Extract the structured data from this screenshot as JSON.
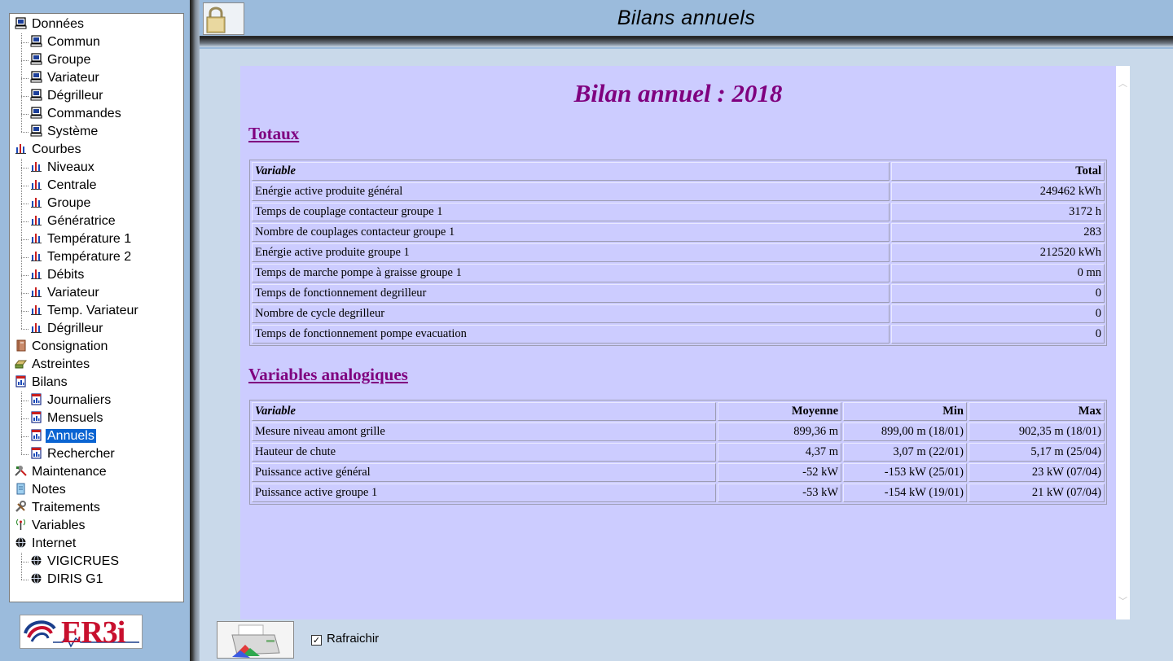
{
  "window": {
    "title": "Bilans annuels"
  },
  "tree": {
    "items": [
      {
        "label": "Données",
        "icon": "computer-icon",
        "level": 0
      },
      {
        "label": "Commun",
        "icon": "computer-icon",
        "level": 1
      },
      {
        "label": "Groupe",
        "icon": "computer-icon",
        "level": 1
      },
      {
        "label": "Variateur",
        "icon": "computer-icon",
        "level": 1
      },
      {
        "label": "Dégrilleur",
        "icon": "computer-icon",
        "level": 1
      },
      {
        "label": "Commandes",
        "icon": "computer-icon",
        "level": 1
      },
      {
        "label": "Système",
        "icon": "computer-icon",
        "level": 1
      },
      {
        "label": "Courbes",
        "icon": "bar-chart-icon",
        "level": 0
      },
      {
        "label": "Niveaux",
        "icon": "bar-chart-icon",
        "level": 1
      },
      {
        "label": "Centrale",
        "icon": "bar-chart-icon",
        "level": 1
      },
      {
        "label": "Groupe",
        "icon": "bar-chart-icon",
        "level": 1
      },
      {
        "label": "Génératrice",
        "icon": "bar-chart-icon",
        "level": 1
      },
      {
        "label": "Température 1",
        "icon": "bar-chart-icon",
        "level": 1
      },
      {
        "label": "Température 2",
        "icon": "bar-chart-icon",
        "level": 1
      },
      {
        "label": "Débits",
        "icon": "bar-chart-icon",
        "level": 1
      },
      {
        "label": "Variateur",
        "icon": "bar-chart-icon",
        "level": 1
      },
      {
        "label": "Temp. Variateur",
        "icon": "bar-chart-icon",
        "level": 1
      },
      {
        "label": "Dégrilleur",
        "icon": "bar-chart-icon",
        "level": 1
      },
      {
        "label": "Consignation",
        "icon": "book-icon",
        "level": 0
      },
      {
        "label": "Astreintes",
        "icon": "tray-icon",
        "level": 0
      },
      {
        "label": "Bilans",
        "icon": "report-icon",
        "level": 0
      },
      {
        "label": "Journaliers",
        "icon": "report-icon",
        "level": 1
      },
      {
        "label": "Mensuels",
        "icon": "report-icon",
        "level": 1
      },
      {
        "label": "Annuels",
        "icon": "report-icon",
        "level": 1,
        "selected": true
      },
      {
        "label": "Rechercher",
        "icon": "report-icon",
        "level": 1
      },
      {
        "label": "Maintenance",
        "icon": "tools-icon",
        "level": 0
      },
      {
        "label": "Notes",
        "icon": "notes-icon",
        "level": 0
      },
      {
        "label": "Traitements",
        "icon": "wrench-icon",
        "level": 0
      },
      {
        "label": "Variables",
        "icon": "antenna-icon",
        "level": 0
      },
      {
        "label": "Internet",
        "icon": "globe-icon",
        "level": 0
      },
      {
        "label": "VIGICRUES",
        "icon": "globe-icon",
        "level": 1
      },
      {
        "label": "DIRIS G1",
        "icon": "globe-icon",
        "level": 1
      }
    ]
  },
  "logo": {
    "text": "ER3i"
  },
  "report": {
    "title": "Bilan annuel : 2018",
    "totaux": {
      "heading": "Totaux",
      "columns": [
        "Variable",
        "Total"
      ],
      "rows": [
        [
          "Enérgie active produite général",
          "249462 kWh"
        ],
        [
          "Temps de couplage contacteur groupe 1",
          "3172 h"
        ],
        [
          "Nombre de couplages contacteur groupe 1",
          "283"
        ],
        [
          "Enérgie active produite groupe 1",
          "212520 kWh"
        ],
        [
          "Temps de marche pompe à graisse groupe 1",
          "0 mn"
        ],
        [
          "Temps de fonctionnement degrilleur",
          "0"
        ],
        [
          "Nombre de cycle degrilleur",
          "0"
        ],
        [
          "Temps de fonctionnement pompe evacuation",
          "0"
        ]
      ]
    },
    "analog": {
      "heading": "Variables analogiques",
      "columns": [
        "Variable",
        "Moyenne",
        "Min",
        "Max"
      ],
      "rows": [
        [
          "Mesure niveau amont grille",
          "899,36 m",
          "899,00 m (18/01)",
          "902,35 m (18/01)"
        ],
        [
          "Hauteur de chute",
          "4,37 m",
          "3,07 m (22/01)",
          "5,17 m (25/04)"
        ],
        [
          "Puissance active général",
          "-52 kW",
          "-153 kW (25/01)",
          "23 kW (07/04)"
        ],
        [
          "Puissance active groupe 1",
          "-53 kW",
          "-154 kW (19/01)",
          "21 kW (07/04)"
        ]
      ]
    }
  },
  "footer": {
    "refresh_label": "Rafraichir",
    "refresh_checked": true,
    "print_icon": "printer-icon",
    "lock_icon": "lock-icon"
  },
  "colors": {
    "window_bg": "#9bbbdc",
    "report_bg": "#ccccff",
    "heading": "#7f007f",
    "selection": "#0a64d2"
  }
}
